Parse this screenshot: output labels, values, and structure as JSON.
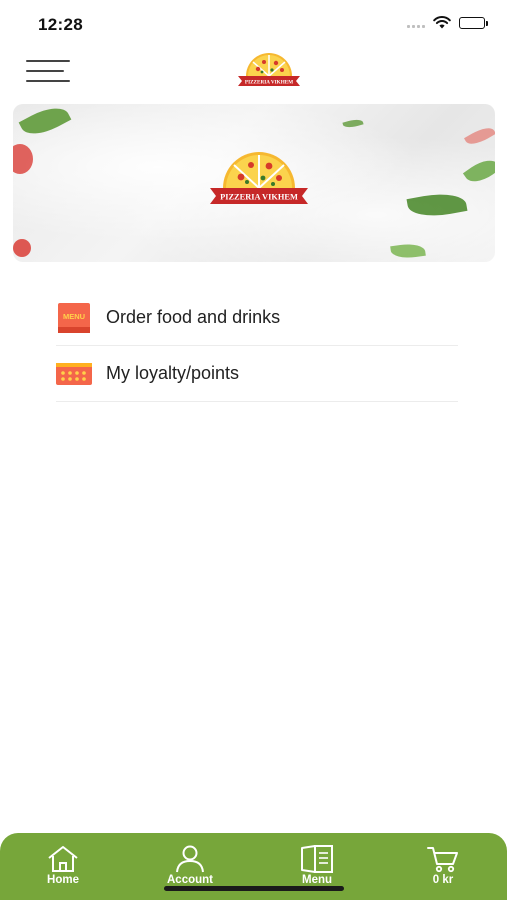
{
  "status_bar": {
    "time": "12:28"
  },
  "header": {
    "logo_text": "PIZZERIA VIKHEM"
  },
  "banner": {
    "logo_text": "PIZZERIA VIKHEM"
  },
  "menu_items": [
    {
      "label": "Order food and drinks",
      "icon": "menu-book-icon",
      "icon_text": "MENU"
    },
    {
      "label": "My loyalty/points",
      "icon": "loyalty-card-icon"
    }
  ],
  "bottom_nav": [
    {
      "label": "Home",
      "icon": "home-icon"
    },
    {
      "label": "Account",
      "icon": "account-icon"
    },
    {
      "label": "Menu",
      "icon": "menu-book-icon"
    },
    {
      "label": "0 kr",
      "icon": "cart-icon"
    }
  ],
  "colors": {
    "nav_green": "#77a63a",
    "accent_red": "#c62828",
    "icon_orange": "#f4664a"
  }
}
